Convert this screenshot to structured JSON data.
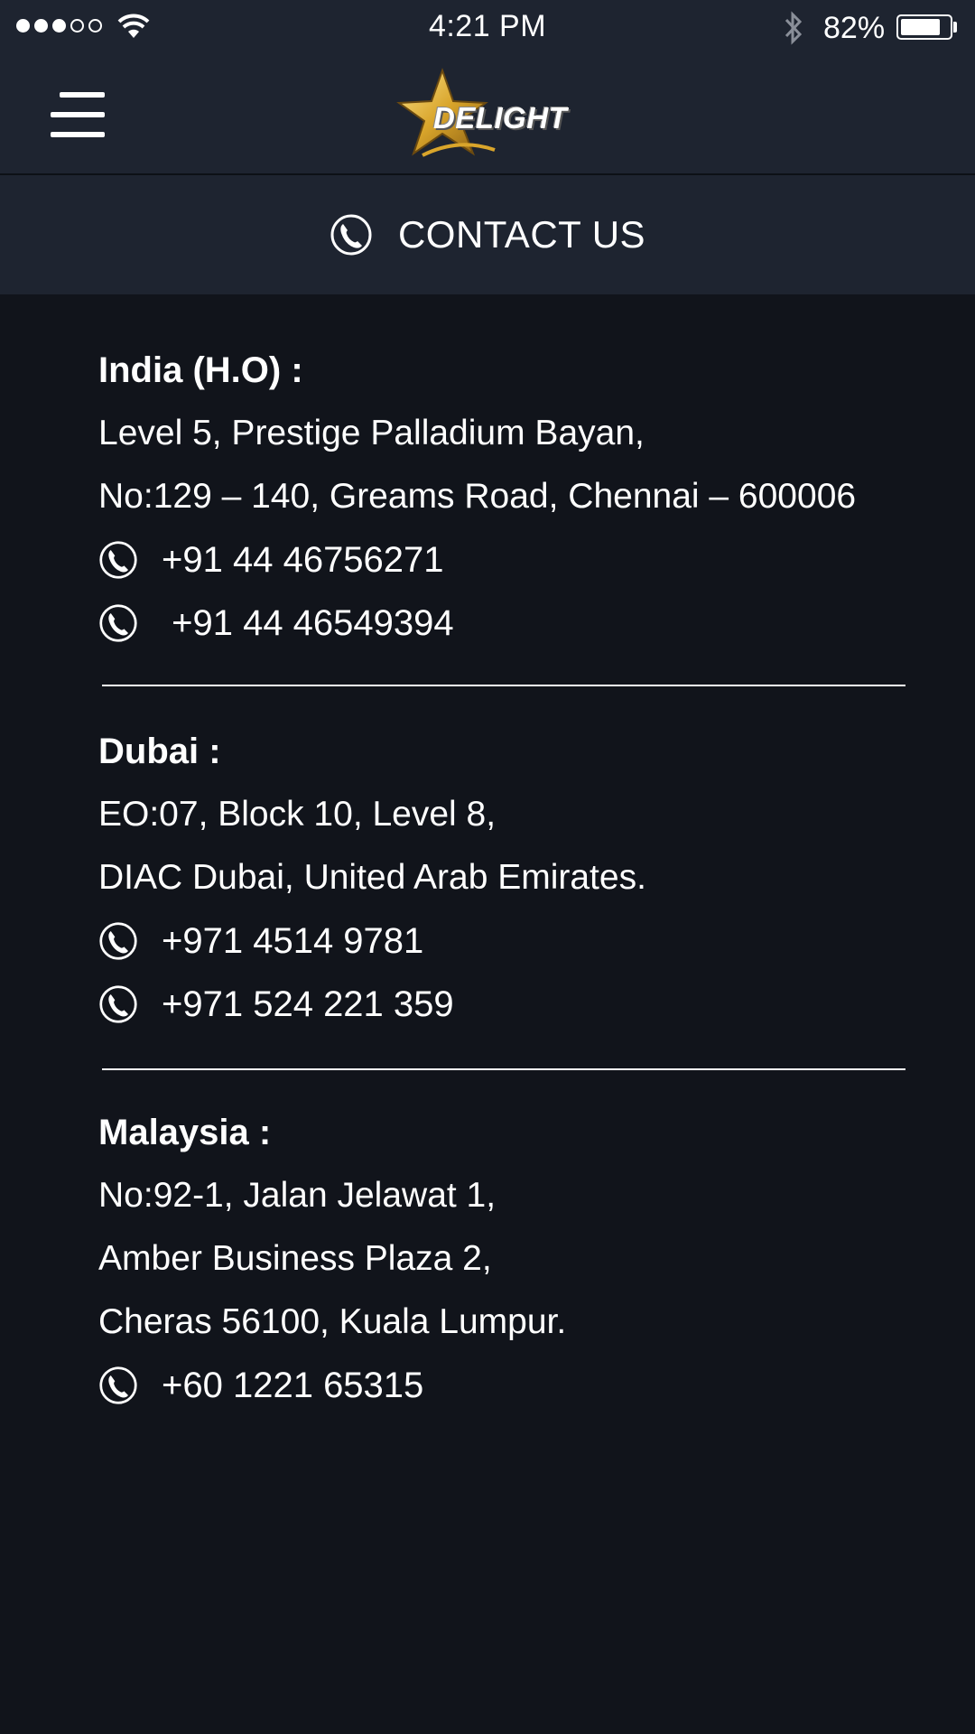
{
  "status_bar": {
    "time": "4:21 PM",
    "battery_percent": "82%",
    "battery_level": 0.82,
    "signal_bars_filled": 3,
    "signal_bars_total": 5
  },
  "header": {
    "logo_text": "DELIGHT",
    "icons": {
      "menu": "hamburger-menu-icon",
      "logo": "star-logo-icon"
    }
  },
  "page": {
    "title": "CONTACT US",
    "title_icon": "phone-icon"
  },
  "offices": [
    {
      "name": "India (H.O) :",
      "address": [
        "Level 5, Prestige Palladium Bayan,",
        "No:129 – 140, Greams Road, Chennai – 600006"
      ],
      "phones": [
        "+91 44 46756271",
        " +91 44 46549394"
      ]
    },
    {
      "name": "Dubai :",
      "address": [
        "EO:07, Block 10, Level 8,",
        "DIAC Dubai, United Arab Emirates."
      ],
      "phones": [
        "+971 4514 9781",
        "+971 524 221 359"
      ]
    },
    {
      "name": "Malaysia :",
      "address": [
        "No:92-1, Jalan Jelawat 1,",
        "Amber Business Plaza 2,",
        "Cheras 56100, Kuala Lumpur."
      ],
      "phones": [
        "+60 1221 65315"
      ]
    }
  ],
  "colors": {
    "background": "#11141b",
    "header": "#1e2430",
    "text": "#ffffff",
    "logo_gold": "#e0b23a"
  }
}
